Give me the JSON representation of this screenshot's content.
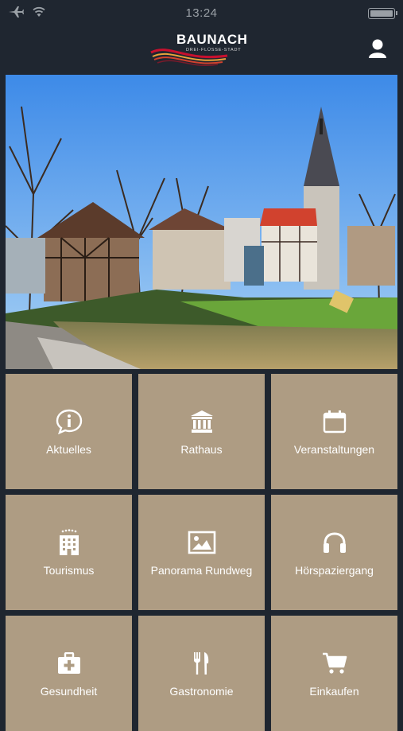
{
  "status": {
    "time": "13:24"
  },
  "header": {
    "logo_title": "BAUNACH",
    "logo_subtitle": "DREI-FLÜSSE-STADT"
  },
  "tiles": [
    {
      "label": "Aktuelles",
      "icon": "info-icon"
    },
    {
      "label": "Rathaus",
      "icon": "building-icon"
    },
    {
      "label": "Veranstaltungen",
      "icon": "calendar-icon"
    },
    {
      "label": "Tourismus",
      "icon": "hotel-icon"
    },
    {
      "label": "Panorama Rundweg",
      "icon": "image-icon"
    },
    {
      "label": "Hörspaziergang",
      "icon": "headphones-icon"
    },
    {
      "label": "Gesundheit",
      "icon": "medkit-icon"
    },
    {
      "label": "Gastronomie",
      "icon": "cutlery-icon"
    },
    {
      "label": "Einkaufen",
      "icon": "cart-icon"
    }
  ],
  "colors": {
    "background": "#1f2630",
    "tile": "#ae9c83",
    "accent_red": "#c8102e"
  }
}
